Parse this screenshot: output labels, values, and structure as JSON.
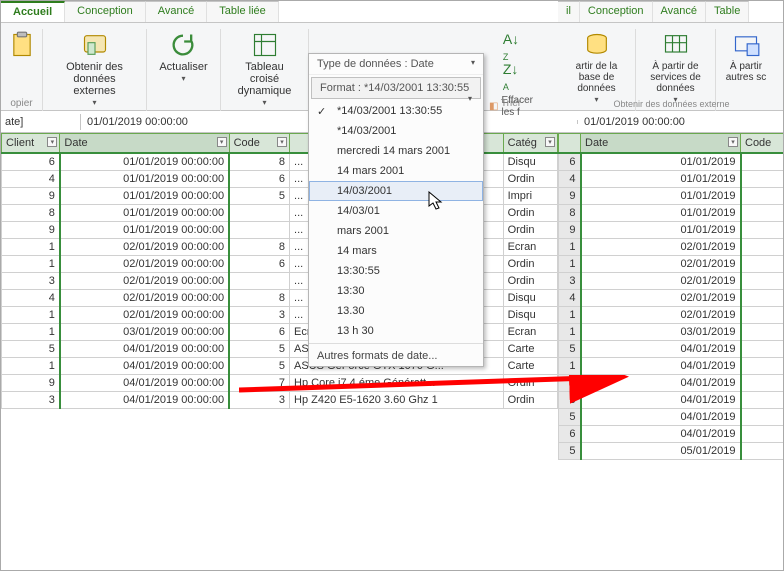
{
  "left": {
    "tabs": [
      "Accueil",
      "Conception",
      "Avancé",
      "Table liée"
    ],
    "ribbon": {
      "copier": "opier",
      "obtenir": "Obtenir des données externes",
      "actualiser": "Actualiser",
      "tcd": "Tableau croisé dynamique",
      "sort_label": "Trier",
      "effacer": "Effacer les f"
    },
    "dropdown": {
      "type_label": "Type de données : Date",
      "format_label": "Format : *14/03/2001 13:30:55",
      "items": [
        "*14/03/2001 13:30:55",
        "*14/03/2001",
        "mercredi 14 mars 2001",
        "14 mars 2001",
        "14/03/2001",
        "14/03/01",
        "mars 2001",
        "14 mars",
        "13:30:55",
        "13:30",
        "13.30",
        "13 h 30"
      ],
      "other": "Autres formats de date..."
    },
    "fbar": {
      "name": "ate]",
      "value": "01/01/2019 00:00:00"
    },
    "headers": [
      "Client",
      "Date",
      "Code",
      "",
      "Catég"
    ],
    "rows": [
      {
        "c": "6",
        "d": "01/01/2019 00:00:00",
        "k": "8",
        "p": "...",
        "g": "Disqu"
      },
      {
        "c": "4",
        "d": "01/01/2019 00:00:00",
        "k": "6",
        "p": "...",
        "g": "Ordin"
      },
      {
        "c": "9",
        "d": "01/01/2019 00:00:00",
        "k": "5",
        "p": "...",
        "g": "Impri"
      },
      {
        "c": "8",
        "d": "01/01/2019 00:00:00",
        "k": "",
        "p": "...",
        "g": "Ordin"
      },
      {
        "c": "9",
        "d": "01/01/2019 00:00:00",
        "k": "",
        "p": "...",
        "g": "Ordin"
      },
      {
        "c": "1",
        "d": "02/01/2019 00:00:00",
        "k": "8",
        "p": "...",
        "g": "Ecran"
      },
      {
        "c": "1",
        "d": "02/01/2019 00:00:00",
        "k": "6",
        "p": "...",
        "g": "Ordin"
      },
      {
        "c": "3",
        "d": "02/01/2019 00:00:00",
        "k": "",
        "p": "...",
        "g": "Ordin"
      },
      {
        "c": "4",
        "d": "02/01/2019 00:00:00",
        "k": "8",
        "p": "...",
        "g": "Disqu"
      },
      {
        "c": "1",
        "d": "02/01/2019 00:00:00",
        "k": "3",
        "p": "...",
        "g": "Disqu"
      },
      {
        "c": "1",
        "d": "03/01/2019 00:00:00",
        "k": "6",
        "p": "Ecran PC LED 24\" Full HD, 5...",
        "g": "Ecran"
      },
      {
        "c": "5",
        "d": "04/01/2019 00:00:00",
        "k": "5",
        "p": "ASUS GeForce GTX 1070 G...",
        "g": "Carte"
      },
      {
        "c": "1",
        "d": "04/01/2019 00:00:00",
        "k": "5",
        "p": "ASUS GeForce GTX 1070 G...",
        "g": "Carte"
      },
      {
        "c": "9",
        "d": "04/01/2019 00:00:00",
        "k": "7",
        "p": "Hp Core i7 4 éme Génératt...",
        "g": "Ordin"
      },
      {
        "c": "3",
        "d": "04/01/2019 00:00:00",
        "k": "3",
        "p": "Hp Z420 E5-1620 3.60 Ghz 1",
        "g": "Ordin"
      }
    ]
  },
  "right": {
    "tabs": [
      "il",
      "Conception",
      "Avancé",
      "Table"
    ],
    "ribbon": {
      "base": "artir de la base de données",
      "services": "À partir de services de données",
      "autres": "À partir autres sc",
      "sub": "Obtenir des données externe"
    },
    "fbar": {
      "value": "01/01/2019 00:00:00"
    },
    "headers": [
      "",
      "Date",
      "Code"
    ],
    "rows": [
      {
        "c": "6",
        "d": "01/01/2019"
      },
      {
        "c": "4",
        "d": "01/01/2019"
      },
      {
        "c": "9",
        "d": "01/01/2019"
      },
      {
        "c": "8",
        "d": "01/01/2019"
      },
      {
        "c": "9",
        "d": "01/01/2019"
      },
      {
        "c": "1",
        "d": "02/01/2019"
      },
      {
        "c": "1",
        "d": "02/01/2019"
      },
      {
        "c": "3",
        "d": "02/01/2019"
      },
      {
        "c": "4",
        "d": "02/01/2019"
      },
      {
        "c": "1",
        "d": "02/01/2019"
      },
      {
        "c": "1",
        "d": "03/01/2019"
      },
      {
        "c": "5",
        "d": "04/01/2019"
      },
      {
        "c": "1",
        "d": "04/01/2019"
      },
      {
        "c": "9",
        "d": "04/01/2019"
      },
      {
        "c": "3",
        "d": "04/01/2019"
      },
      {
        "c": "5",
        "d": "04/01/2019"
      },
      {
        "c": "6",
        "d": "04/01/2019"
      },
      {
        "c": "5",
        "d": "05/01/2019"
      }
    ]
  }
}
